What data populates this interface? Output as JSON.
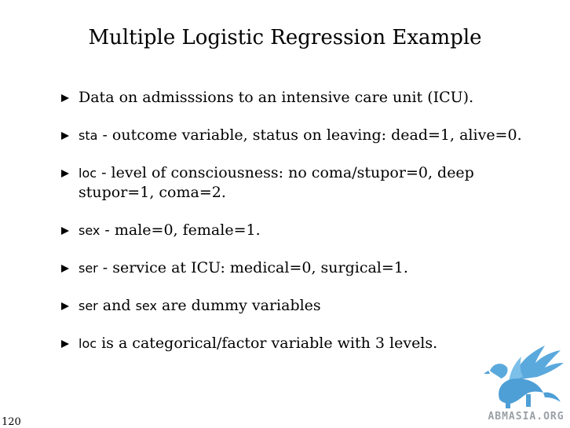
{
  "slide": {
    "title": "Multiple Logistic Regression Example",
    "bullets": [
      {
        "code": "",
        "text": "Data on admisssions to an intensive care unit (ICU)."
      },
      {
        "code": "sta",
        "text": " - outcome variable, status on leaving: dead=1, alive=0."
      },
      {
        "code": "loc",
        "text": " - level of consciousness: no coma/stupor=0, deep stupor=1, coma=2."
      },
      {
        "code": "sex",
        "text": " - male=0, female=1."
      },
      {
        "code": "ser",
        "text": " - service at ICU: medical=0, surgical=1."
      },
      {
        "code": "ser",
        "text": " and ",
        "code2": "sex",
        "text2": " are dummy variables"
      },
      {
        "code": "loc",
        "text": " is a categorical/factor variable with 3 levels."
      }
    ],
    "page_number": "120",
    "logo_text": "ABMASIA.ORG"
  },
  "colors": {
    "logo": "#5aa9dd",
    "logo_text": "#9aa0a6"
  },
  "icons": {
    "bullet": "triangle-bullet-icon",
    "logo": "griffin-logo-icon"
  }
}
